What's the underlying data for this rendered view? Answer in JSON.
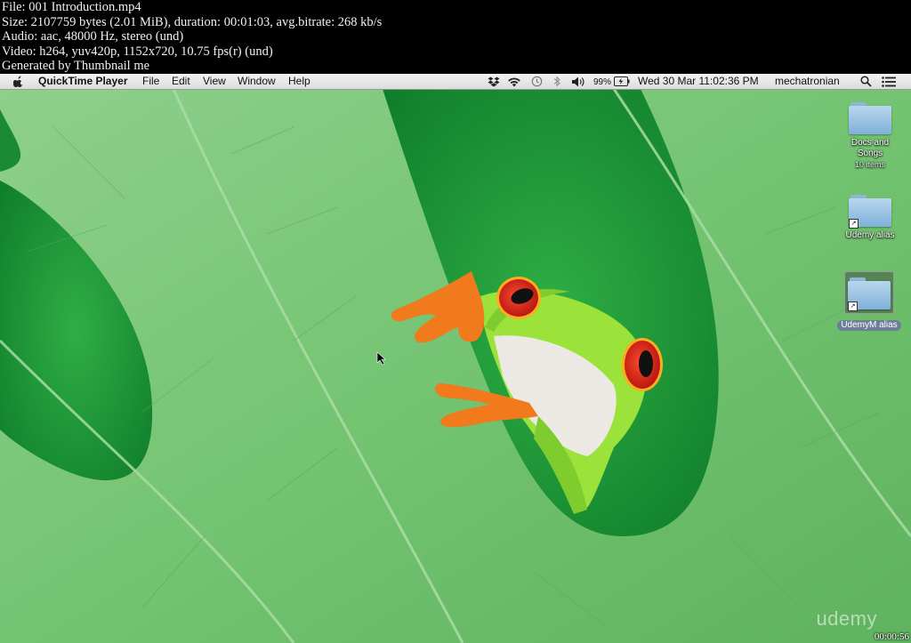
{
  "info": {
    "line1": "File: 001 Introduction.mp4",
    "line2": "Size: 2107759 bytes (2.01 MiB), duration: 00:01:03, avg.bitrate: 268 kb/s",
    "line3": "Audio: aac, 48000 Hz, stereo (und)",
    "line4": "Video: h264, yuv420p, 1152x720, 10.75 fps(r) (und)",
    "line5": "Generated by Thumbnail me"
  },
  "menubar": {
    "app": "QuickTime Player",
    "items": [
      "File",
      "Edit",
      "View",
      "Window",
      "Help"
    ],
    "battery": "99%",
    "clock": "Wed 30 Mar  11:02:36 PM",
    "user": "mechatronian",
    "status_icons": [
      "dropbox-icon",
      "wifi-icon",
      "time-machine-icon",
      "bluetooth-icon",
      "volume-icon",
      "battery-icon",
      "spotlight-icon",
      "notification-center-icon"
    ]
  },
  "desktop": {
    "icons": [
      {
        "label": "Docs and Songs",
        "sub": "10 items"
      },
      {
        "label": "Udemy alias"
      },
      {
        "label": "UdemyM alias"
      }
    ]
  },
  "overlay": {
    "watermark": "udemy",
    "timecode": "00:00:56"
  },
  "colors": {
    "leaf": "#7cc47a",
    "background_green": "#1e9a3a",
    "frog_green": "#9ee33a",
    "frog_orange": "#f07a1c",
    "eye_red": "#d8241c"
  }
}
